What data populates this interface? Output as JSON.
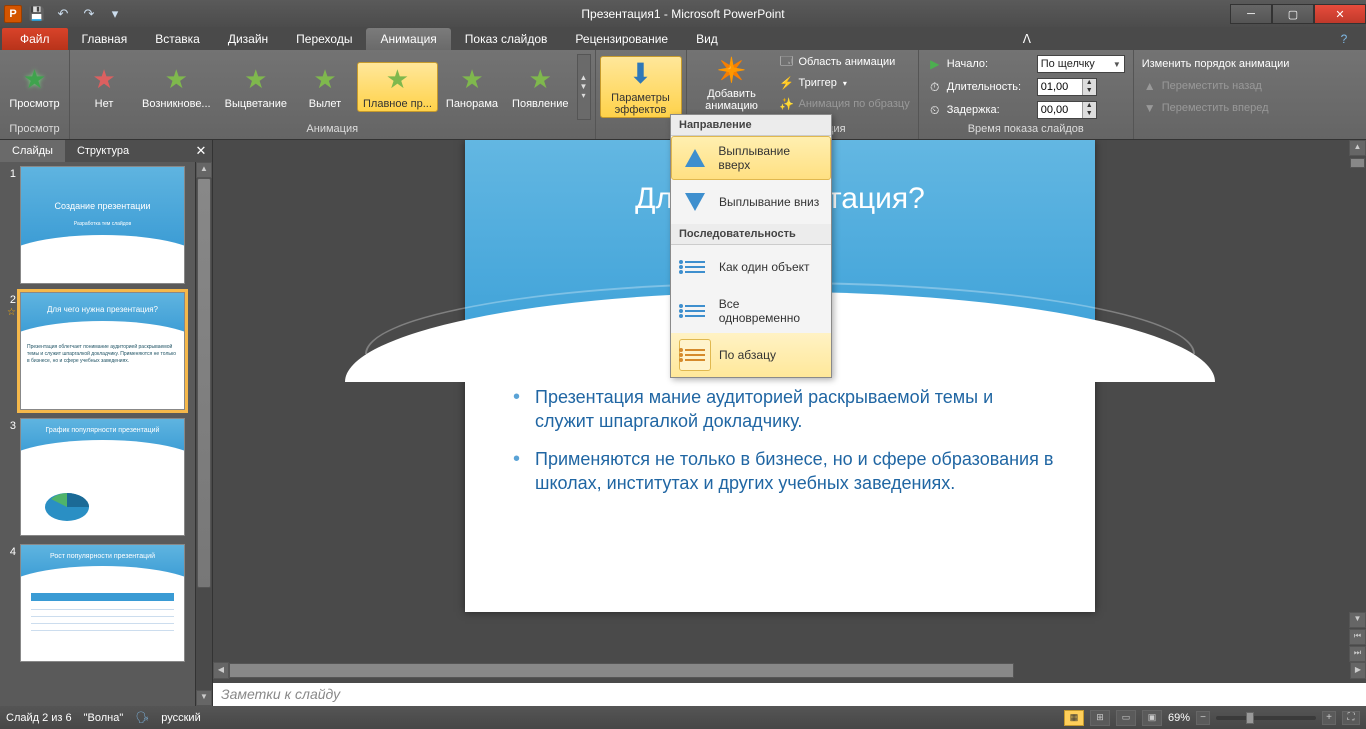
{
  "titlebar": {
    "title": "Презентация1 - Microsoft PowerPoint",
    "qat": {
      "save": "💾",
      "undo": "↶",
      "redo": "↷"
    }
  },
  "tabs": {
    "file": "Файл",
    "items": [
      "Главная",
      "Вставка",
      "Дизайн",
      "Переходы",
      "Анимация",
      "Показ слайдов",
      "Рецензирование",
      "Вид"
    ],
    "active_index": 4
  },
  "ribbon": {
    "preview": {
      "label": "Просмотр",
      "group": "Просмотр"
    },
    "animation_group": "Анимация",
    "effects": [
      {
        "name": "Нет",
        "color": "#dc6060"
      },
      {
        "name": "Возникнове...",
        "color": "#7fb84d"
      },
      {
        "name": "Выцветание",
        "color": "#7fb84d"
      },
      {
        "name": "Вылет",
        "color": "#7fb84d"
      },
      {
        "name": "Плавное пр...",
        "color": "#7fb84d",
        "selected": true
      },
      {
        "name": "Панорама",
        "color": "#7fb84d"
      },
      {
        "name": "Появление",
        "color": "#7fb84d"
      }
    ],
    "effect_options": {
      "label": "Параметры эффектов"
    },
    "advanced": {
      "group": "...нная анимация",
      "add": "Добавить анимацию",
      "pane": "Область анимации",
      "trigger": "Триггер",
      "painter": "Анимация по образцу"
    },
    "timing": {
      "group": "Время показа слайдов",
      "start_label": "Начало:",
      "start_value": "По щелчку",
      "duration_label": "Длительность:",
      "duration_value": "01,00",
      "delay_label": "Задержка:",
      "delay_value": "00,00"
    },
    "reorder": {
      "header": "Изменить порядок анимации",
      "earlier": "Переместить назад",
      "later": "Переместить вперед"
    }
  },
  "dropdown": {
    "section1": "Направление",
    "opt1": "Выплывание вверх",
    "opt2": "Выплывание вниз",
    "section2": "Последовательность",
    "opt3": "Как один объект",
    "opt4": "Все одновременно",
    "opt5": "По абзацу"
  },
  "leftpanel": {
    "tab_slides": "Слайды",
    "tab_outline": "Структура",
    "thumbs": [
      {
        "n": "1",
        "title": "Создание презентации",
        "sub": "Разработка тем слайдов"
      },
      {
        "n": "2",
        "title": "Для чего нужна презентация?",
        "body": "Презентация облегчает понимание аудиторией раскрываемой темы и служит шпаргалкой докладчику. Применяются не только в бизнесе, но и сфере учебных заведениях."
      },
      {
        "n": "3",
        "title": "График популярности презентаций"
      },
      {
        "n": "4",
        "title": "Рост популярности презентаций"
      }
    ]
  },
  "slide": {
    "title": "Для чего нужна презентация?",
    "title_behind": "Для чего                            езентация?",
    "bullets": [
      "Презентация облегчает понимание аудиторией раскрываемой темы и служит шпаргалкой докладчику.",
      "Применяются не только в бизнесе, но и сфере образования в школах, институтах и других учебных заведениях."
    ],
    "bullet1_masked": "Презентация                               мание аудиторией раскрываемой темы и служит шпаргалкой докладчику."
  },
  "notes": "Заметки к слайду",
  "status": {
    "slide": "Слайд 2 из 6",
    "theme": "\"Волна\"",
    "lang": "русский",
    "zoom": "69%"
  }
}
